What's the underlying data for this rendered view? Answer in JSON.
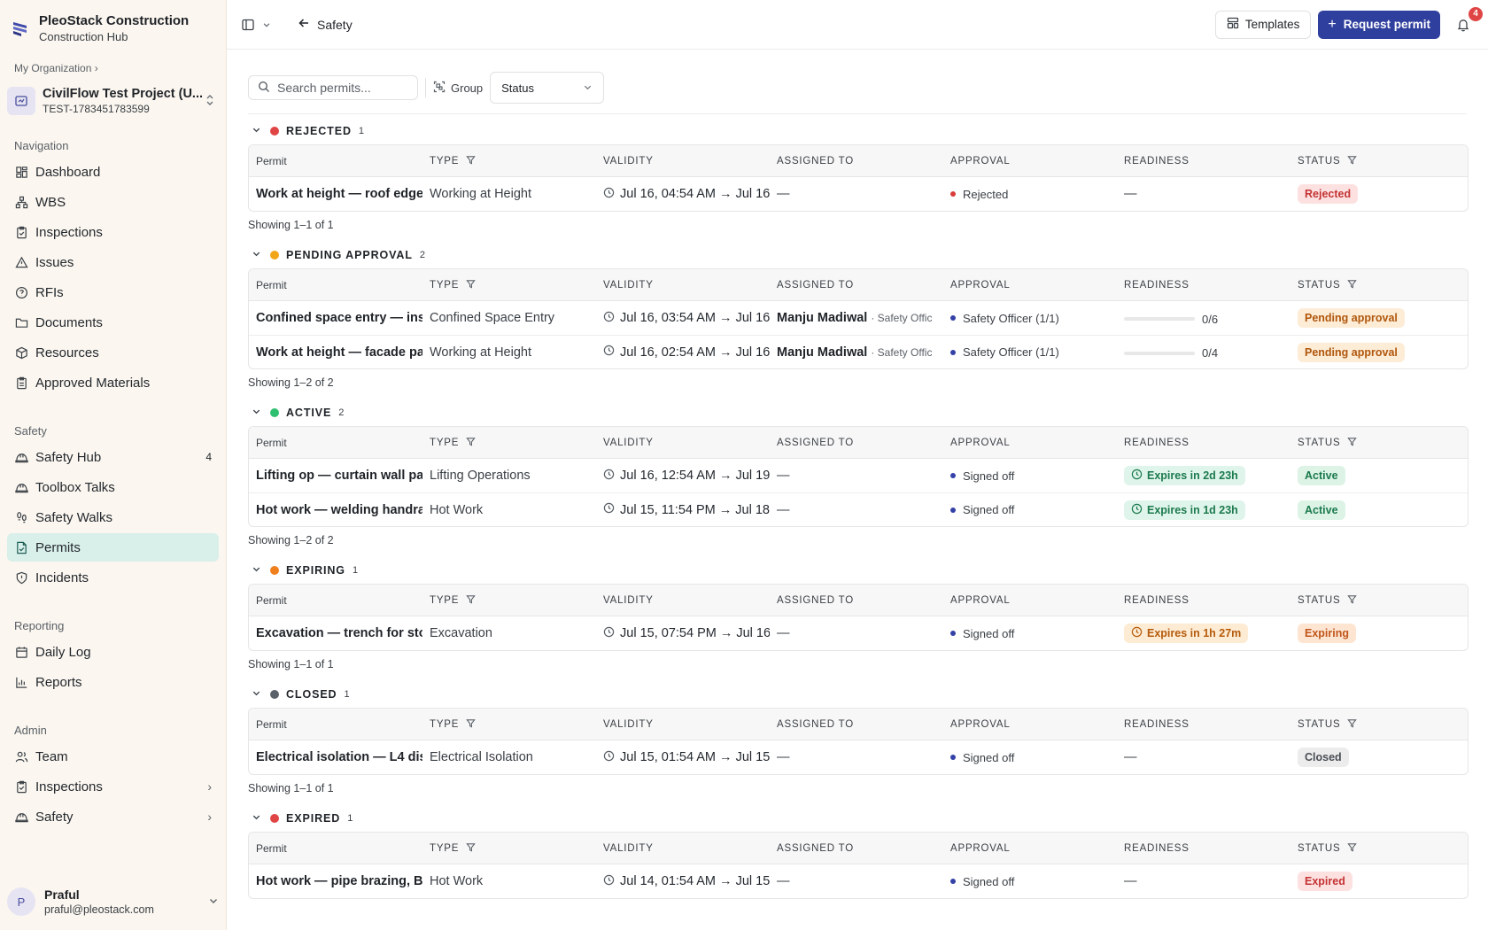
{
  "brand": {
    "name": "PleoStack Construction",
    "sub": "Construction Hub"
  },
  "org": {
    "crumb": "My Organization ›"
  },
  "project": {
    "name": "CivilFlow Test Project (U...",
    "code": "TEST-1783451783599"
  },
  "sidebar": {
    "navigation_title": "Navigation",
    "navigation": [
      {
        "label": "Dashboard",
        "icon": "dashboard-icon"
      },
      {
        "label": "WBS",
        "icon": "hierarchy-icon"
      },
      {
        "label": "Inspections",
        "icon": "clipboard-icon"
      },
      {
        "label": "Issues",
        "icon": "warning-icon"
      },
      {
        "label": "RFIs",
        "icon": "question-icon"
      },
      {
        "label": "Documents",
        "icon": "folder-icon"
      },
      {
        "label": "Resources",
        "icon": "box-icon"
      },
      {
        "label": "Approved Materials",
        "icon": "clipboard-check-icon"
      }
    ],
    "safety_title": "Safety",
    "safety": [
      {
        "label": "Safety Hub",
        "icon": "helmet-icon",
        "count": "4"
      },
      {
        "label": "Toolbox Talks",
        "icon": "helmet-icon"
      },
      {
        "label": "Safety Walks",
        "icon": "footprints-icon"
      },
      {
        "label": "Permits",
        "icon": "file-check-icon"
      },
      {
        "label": "Incidents",
        "icon": "shield-alert-icon"
      }
    ],
    "reporting_title": "Reporting",
    "reporting": [
      {
        "label": "Daily Log",
        "icon": "calendar-icon"
      },
      {
        "label": "Reports",
        "icon": "bar-chart-icon"
      }
    ],
    "admin_title": "Admin",
    "admin": [
      {
        "label": "Team",
        "icon": "users-icon"
      },
      {
        "label": "Inspections",
        "icon": "clipboard-icon"
      },
      {
        "label": "Safety",
        "icon": "helmet-icon"
      }
    ]
  },
  "user": {
    "initial": "P",
    "name": "Praful",
    "email": "praful@pleostack.com"
  },
  "topbar": {
    "back_label": "Safety",
    "templates_label": "Templates",
    "request_label": "Request permit",
    "notification_count": "4"
  },
  "filters": {
    "search_placeholder": "Search permits...",
    "group_label": "Group",
    "group_value": "Status"
  },
  "columns": {
    "permit": "Permit",
    "type": "TYPE",
    "validity": "VALIDITY",
    "assigned": "ASSIGNED TO",
    "approval": "APPROVAL",
    "readiness": "READINESS",
    "status": "STATUS"
  },
  "colors": {
    "rejected": "#e04545",
    "pending": "#f2a516",
    "active": "#2fbf71",
    "expiring": "#f07f1e",
    "closed": "#5b6168",
    "expired": "#e04545",
    "primary": "#2f3f9e"
  },
  "groups": [
    {
      "title": "REJECTED",
      "count": "1",
      "showing": "Showing 1–1 of 1",
      "dot": "#e04545",
      "rows": [
        {
          "permit": "Work at height — roof edge",
          "type": "Working at Height",
          "validity": "Jul 16, 04:54 AM → Jul 16",
          "assigned": "—",
          "role": "",
          "approval": "Rejected",
          "approval_dot": "red",
          "readiness": "—",
          "status": "Rejected",
          "status_class": "rejected"
        }
      ]
    },
    {
      "title": "PENDING APPROVAL",
      "count": "2",
      "showing": "Showing 1–2 of 2",
      "dot": "#f2a516",
      "rows": [
        {
          "permit": "Confined space entry — ins",
          "type": "Confined Space Entry",
          "validity": "Jul 16, 03:54 AM → Jul 16",
          "assigned": "Manju Madiwal",
          "role": "· Safety Offic",
          "approval": "Safety Officer (1/1)",
          "approval_dot": "blue",
          "readiness_progress": "0/6",
          "readiness_fraction": 0,
          "status": "Pending approval",
          "status_class": "pending"
        },
        {
          "permit": "Work at height — facade pa",
          "type": "Working at Height",
          "validity": "Jul 16, 02:54 AM → Jul 16",
          "assigned": "Manju Madiwal",
          "role": "· Safety Offic",
          "approval": "Safety Officer (1/1)",
          "approval_dot": "blue",
          "readiness_progress": "0/4",
          "readiness_fraction": 0,
          "status": "Pending approval",
          "status_class": "pending"
        }
      ]
    },
    {
      "title": "ACTIVE",
      "count": "2",
      "showing": "Showing 1–2 of 2",
      "dot": "#2fbf71",
      "rows": [
        {
          "permit": "Lifting op — curtain wall pa",
          "type": "Lifting Operations",
          "validity": "Jul 16, 12:54 AM → Jul 19,",
          "assigned": "—",
          "role": "",
          "approval": "Signed off",
          "approval_dot": "blue",
          "readiness_expiry": "Expires in 2d 23h",
          "expiry_tone": "green",
          "status": "Active",
          "status_class": "active"
        },
        {
          "permit": "Hot work — welding handra",
          "type": "Hot Work",
          "validity": "Jul 15, 11:54 PM → Jul 18,",
          "assigned": "—",
          "role": "",
          "approval": "Signed off",
          "approval_dot": "blue",
          "readiness_expiry": "Expires in 1d 23h",
          "expiry_tone": "green",
          "status": "Active",
          "status_class": "active"
        }
      ]
    },
    {
      "title": "EXPIRING",
      "count": "1",
      "showing": "Showing 1–1 of 1",
      "dot": "#f07f1e",
      "rows": [
        {
          "permit": "Excavation — trench for sto",
          "type": "Excavation",
          "validity": "Jul 15, 07:54 PM → Jul 16,",
          "assigned": "—",
          "role": "",
          "approval": "Signed off",
          "approval_dot": "blue",
          "readiness_expiry": "Expires in 1h 27m",
          "expiry_tone": "orange",
          "status": "Expiring",
          "status_class": "expiring"
        }
      ]
    },
    {
      "title": "CLOSED",
      "count": "1",
      "showing": "Showing 1–1 of 1",
      "dot": "#5b6168",
      "rows": [
        {
          "permit": "Electrical isolation — L4 dis",
          "type": "Electrical Isolation",
          "validity": "Jul 15, 01:54 AM → Jul 15,",
          "assigned": "—",
          "role": "",
          "approval": "Signed off",
          "approval_dot": "blue",
          "readiness": "—",
          "status": "Closed",
          "status_class": "closed"
        }
      ]
    },
    {
      "title": "EXPIRED",
      "count": "1",
      "showing": "",
      "dot": "#e04545",
      "rows": [
        {
          "permit": "Hot work — pipe brazing, B",
          "type": "Hot Work",
          "validity": "Jul 14, 01:54 AM → Jul 15",
          "assigned": "—",
          "role": "",
          "approval": "Signed off",
          "approval_dot": "blue",
          "readiness": "—",
          "status": "Expired",
          "status_class": "expired"
        }
      ]
    }
  ]
}
